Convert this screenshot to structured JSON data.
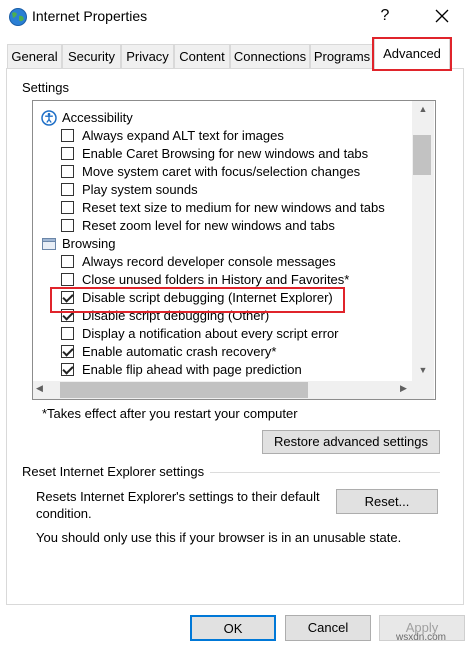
{
  "window": {
    "title": "Internet Properties",
    "help_glyph": "?",
    "close_glyph": "✕"
  },
  "tabs": [
    {
      "label": "General"
    },
    {
      "label": "Security"
    },
    {
      "label": "Privacy"
    },
    {
      "label": "Content"
    },
    {
      "label": "Connections"
    },
    {
      "label": "Programs"
    },
    {
      "label": "Advanced",
      "selected": true
    }
  ],
  "settings": {
    "heading": "Settings",
    "groups": [
      {
        "label": "Accessibility",
        "icon": "accessibility-icon",
        "items": [
          {
            "label": "Always expand ALT text for images",
            "checked": false
          },
          {
            "label": "Enable Caret Browsing for new windows and tabs",
            "checked": false
          },
          {
            "label": "Move system caret with focus/selection changes",
            "checked": false
          },
          {
            "label": "Play system sounds",
            "checked": false
          },
          {
            "label": "Reset text size to medium for new windows and tabs",
            "checked": false
          },
          {
            "label": "Reset zoom level for new windows and tabs",
            "checked": false
          }
        ]
      },
      {
        "label": "Browsing",
        "icon": "browsing-folder-icon",
        "items": [
          {
            "label": "Always record developer console messages",
            "checked": false
          },
          {
            "label": "Close unused folders in History and Favorites*",
            "checked": false
          },
          {
            "label": "Disable script debugging (Internet Explorer)",
            "checked": true
          },
          {
            "label": "Disable script debugging (Other)",
            "checked": true
          },
          {
            "label": "Display a notification about every script error",
            "checked": false
          },
          {
            "label": "Enable automatic crash recovery*",
            "checked": true
          },
          {
            "label": "Enable flip ahead with page prediction",
            "checked": true
          }
        ]
      }
    ],
    "note": "*Takes effect after you restart your computer",
    "restore_button": "Restore advanced settings"
  },
  "reset": {
    "group_label": "Reset Internet Explorer settings",
    "description": "Resets Internet Explorer's settings to their default condition.",
    "button": "Reset...",
    "warning": "You should only use this if your browser is in an unusable state."
  },
  "footer": {
    "ok": "OK",
    "cancel": "Cancel",
    "apply": "Apply",
    "watermark": "wsxdn.com"
  },
  "colors": {
    "highlight": "#e0242b",
    "default_button_border": "#0078d7"
  }
}
